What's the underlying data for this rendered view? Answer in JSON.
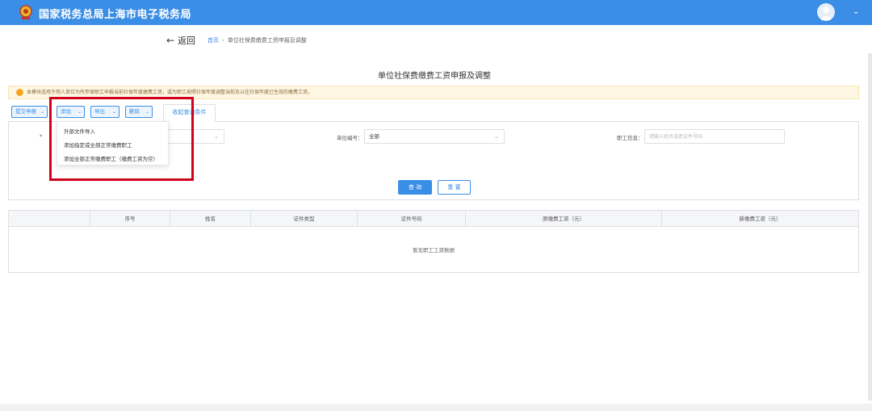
{
  "header": {
    "site_title": "国家税务总局上海市电子税务局",
    "logo_icon": "tax-emblem-icon",
    "avatar_icon": "user-avatar-icon",
    "user_menu_icon": "chevron-down-icon",
    "accent_color": "#3a8ee6"
  },
  "nav": {
    "back_label": "返回",
    "breadcrumb": {
      "home": "首页",
      "separator": "›",
      "current": "单位社保费缴费工资申报及调整"
    }
  },
  "page": {
    "title": "单位社保费缴费工资申报及调整",
    "notice": "本模块适用于用人单位为所参保职工申报当前社保年度缴费工资，或为职工按照社保年度调整当前及以往社保年度已生效的缴费工资。"
  },
  "toolbar": {
    "submit_label": "提交申报",
    "add_label": "添加",
    "export_label": "导出",
    "delete_label": "删除",
    "collapse_label": "收起查询条件"
  },
  "add_menu": {
    "items": [
      "外部文件导入",
      "添加指定或全部正常缴费职工",
      "添加全部正常缴费职工（缴费工资为空）"
    ]
  },
  "query": {
    "field1_label": "*",
    "field1_value": "",
    "unit_no_label": "单位编号：",
    "unit_no_value": "全部",
    "employee_label": "职工信息：",
    "employee_placeholder": "请输入姓名或者证件号码",
    "query_button": "查 询",
    "reset_button": "重 置"
  },
  "grid": {
    "columns": [
      "",
      "序号",
      "姓名",
      "证件类型",
      "证件号码",
      "原缴费工资（元）",
      "新缴费工资（元）"
    ],
    "empty_text": "暂无职工工资数据"
  },
  "highlight_color": "#d0021b"
}
